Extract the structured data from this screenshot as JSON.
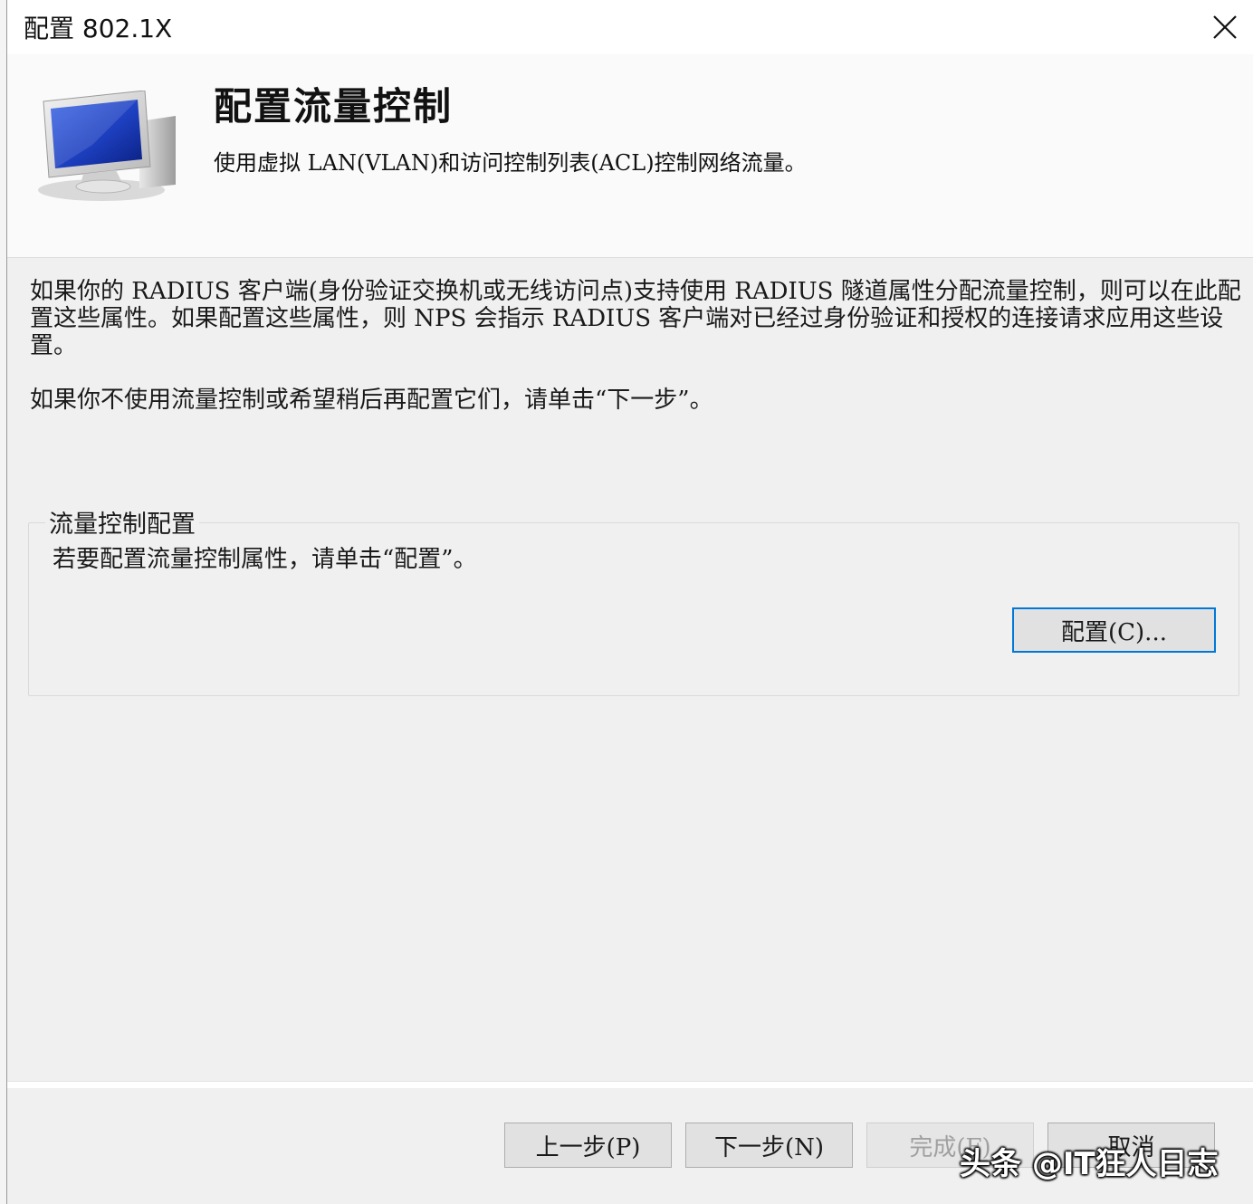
{
  "window": {
    "title": "配置 802.1X",
    "close_icon": "close-icon"
  },
  "header": {
    "title": "配置流量控制",
    "subtitle": "使用虚拟 LAN(VLAN)和访问控制列表(ACL)控制网络流量。",
    "icon": "monitor-icon"
  },
  "main": {
    "paragraph1": "如果你的 RADIUS 客户端(身份验证交换机或无线访问点)支持使用 RADIUS 隧道属性分配流量控制，则可以在此配置这些属性。如果配置这些属性，则 NPS 会指示 RADIUS 客户端对已经过身份验证和授权的连接请求应用这些设置。",
    "paragraph2": "如果你不使用流量控制或希望稍后再配置它们，请单击“下一步”。",
    "group": {
      "legend": "流量控制配置",
      "description": "若要配置流量控制属性，请单击“配置”。",
      "config_button": "配置(C)..."
    }
  },
  "footer": {
    "prev_button": "上一步(P)",
    "next_button": "下一步(N)",
    "finish_button": "完成(F)",
    "cancel_button": "取消"
  },
  "watermark": "头条 @IT狂人日志",
  "colors": {
    "dialog_bg": "#f0f0f0",
    "header_bg": "#fafafa",
    "focus_border": "#0078d7"
  }
}
